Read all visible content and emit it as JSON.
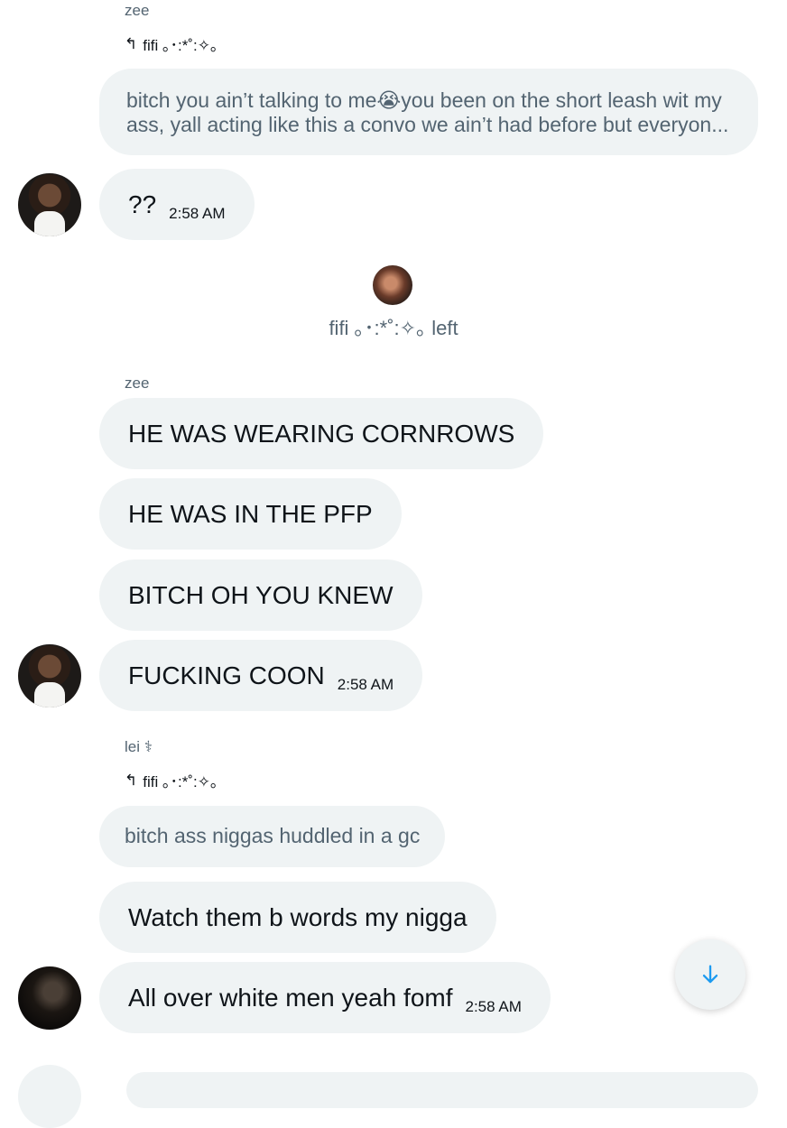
{
  "messages": {
    "m1": {
      "sender": "zee",
      "reply_to": "fifi ｡･:*˚:✧｡",
      "quote": "bitch you ain’t talking to me😭you been on the short leash wit my ass, yall acting like this a convo we ain’t had before but everyon...",
      "text": "??",
      "time": "2:58 AM"
    },
    "system_event": {
      "text": "fifi ｡･:*˚:✧｡ left"
    },
    "group2": {
      "sender": "zee",
      "items": [
        "HE WAS WEARING CORNROWS",
        "HE WAS IN THE PFP",
        "BITCH OH YOU KNEW",
        "FUCKING COON"
      ],
      "time": "2:58 AM"
    },
    "group3": {
      "sender": "lei ⚕",
      "reply_to": "fifi ｡･:*˚:✧｡",
      "quote": "bitch ass niggas huddled in a gc",
      "items": [
        "Watch them b words my nigga",
        "All over white men yeah fomf"
      ],
      "time": "2:58 AM"
    }
  },
  "icons": {
    "reply": "reply-arrow-icon",
    "scroll_down": "arrow-down-icon"
  },
  "colors": {
    "bubble": "#eff3f4",
    "secondary_text": "#536471",
    "accent": "#1d9bf0"
  }
}
